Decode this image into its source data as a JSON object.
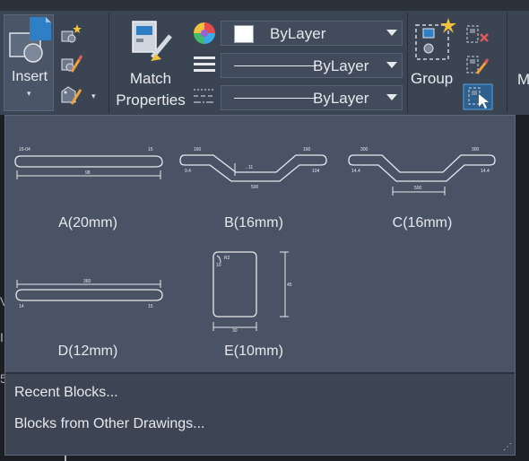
{
  "ribbon": {
    "insert": {
      "label": "Insert",
      "caret": "▾"
    },
    "match_properties": {
      "line1": "Match",
      "line2": "Properties"
    },
    "properties": {
      "color_value": "ByLayer",
      "linetype_value": "ByLayer",
      "lineweight_value": "ByLayer"
    },
    "group": {
      "label": "Group"
    },
    "cut_label": "M"
  },
  "dropdown": {
    "blocks": [
      {
        "caption": "A(20mm)",
        "icon": "block-a-preview"
      },
      {
        "caption": "B(16mm)",
        "icon": "block-b-preview"
      },
      {
        "caption": "C(16mm)",
        "icon": "block-c-preview"
      },
      {
        "caption": "D(12mm)",
        "icon": "block-d-preview"
      },
      {
        "caption": "E(10mm)",
        "icon": "block-e-preview"
      }
    ],
    "menu": {
      "recent_blocks": "Recent Blocks...",
      "other_drawings": "Blocks from Other Drawings..."
    }
  },
  "colors": {
    "ribbon_bg": "#3b4453",
    "dropdown_bg": "#4a5365",
    "footer_bg": "#3d4555",
    "accent_blue": "#2f7fc6"
  }
}
